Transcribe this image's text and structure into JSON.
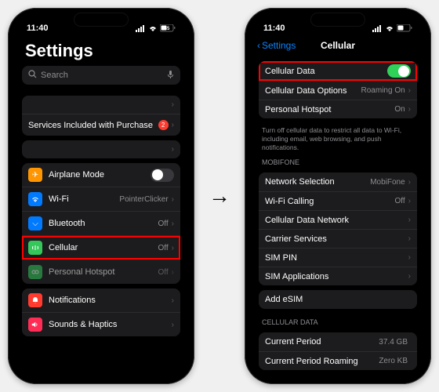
{
  "status": {
    "time": "11:40",
    "battery": "45"
  },
  "left": {
    "title": "Settings",
    "search_placeholder": "Search",
    "services_label": "Services Included with Purchase",
    "services_badge": "2",
    "airplane": "Airplane Mode",
    "wifi": {
      "label": "Wi-Fi",
      "value": "PointerClicker"
    },
    "bluetooth": {
      "label": "Bluetooth",
      "value": "Off"
    },
    "cellular": {
      "label": "Cellular",
      "value": "Off"
    },
    "hotspot": {
      "label": "Personal Hotspot",
      "value": "Off"
    },
    "notifications": "Notifications",
    "sounds": "Sounds & Haptics"
  },
  "right": {
    "back": "Settings",
    "title": "Cellular",
    "cellular_data": "Cellular Data",
    "data_options": {
      "label": "Cellular Data Options",
      "value": "Roaming On"
    },
    "hotspot": {
      "label": "Personal Hotspot",
      "value": "On"
    },
    "footer": "Turn off cellular data to restrict all data to Wi-Fi, including email, web browsing, and push notifications.",
    "carrier_header": "MOBIFONE",
    "network_sel": {
      "label": "Network Selection",
      "value": "MobiFone"
    },
    "wifi_call": {
      "label": "Wi-Fi Calling",
      "value": "Off"
    },
    "data_network": "Cellular Data Network",
    "carrier_services": "Carrier Services",
    "sim_pin": "SIM PIN",
    "sim_apps": "SIM Applications",
    "add_esim": "Add eSIM",
    "data_header": "CELLULAR DATA",
    "current_period": {
      "label": "Current Period",
      "value": "37.4 GB"
    },
    "roaming": {
      "label": "Current Period Roaming",
      "value": "Zero KB"
    }
  }
}
